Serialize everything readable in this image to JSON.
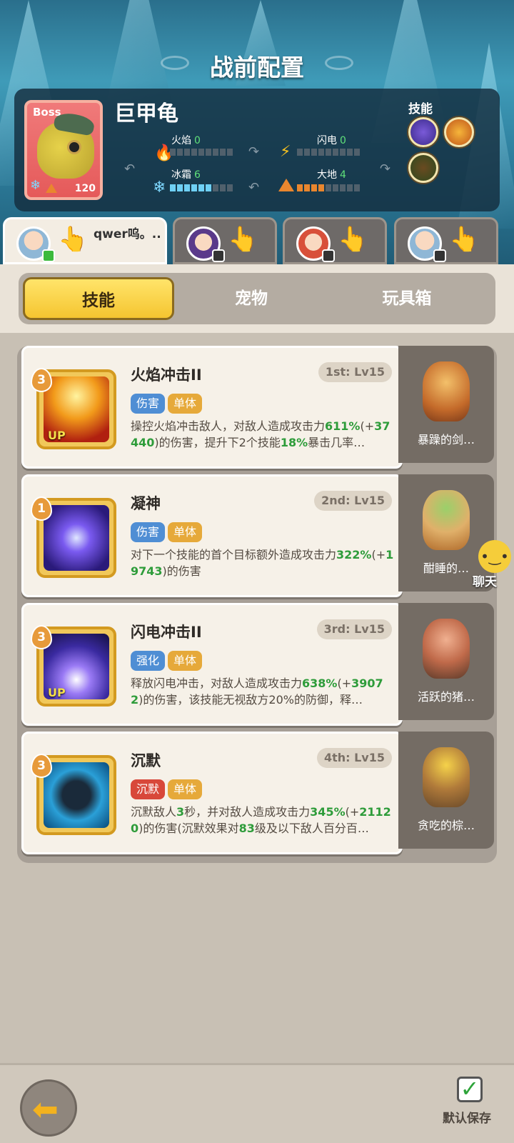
{
  "header": {
    "title": "战前配置"
  },
  "boss": {
    "tag": "Boss",
    "name": "巨甲龟",
    "level": "120",
    "stats": {
      "fire": {
        "label": "火焰",
        "value": "0"
      },
      "lightning": {
        "label": "闪电",
        "value": "0"
      },
      "ice": {
        "label": "冰霜",
        "value": "6"
      },
      "earth": {
        "label": "大地",
        "value": "4"
      }
    },
    "skills_label": "技能"
  },
  "players": [
    {
      "name": "qwer呜。.."
    },
    {
      "name": ""
    },
    {
      "name": ""
    },
    {
      "name": ""
    }
  ],
  "tabs": {
    "skills": "技能",
    "pets": "宠物",
    "toybox": "玩具箱"
  },
  "skills": [
    {
      "name": "火焰冲击II",
      "slot": "1st: Lv15",
      "level": "3",
      "up": "UP",
      "tags": [
        "伤害",
        "单体"
      ],
      "desc_a": "操控火焰冲击敌人，对敌人造成攻击力",
      "desc_b": "611%",
      "desc_c": "(+",
      "desc_d": "37440",
      "desc_e": ")的伤害，提升下2个技能",
      "desc_f": "18%",
      "desc_g": "暴击几率…",
      "pet": "暴躁的剑…"
    },
    {
      "name": "凝神",
      "slot": "2nd: Lv15",
      "level": "1",
      "tags": [
        "伤害",
        "单体"
      ],
      "desc_a": "对下一个技能的首个目标额外造成攻击力",
      "desc_b": "322%",
      "desc_c": "(+",
      "desc_d": "19743",
      "desc_e": ")的伤害",
      "pet": "酣睡的…"
    },
    {
      "name": "闪电冲击II",
      "slot": "3rd: Lv15",
      "level": "3",
      "up": "UP",
      "tags": [
        "强化",
        "单体"
      ],
      "desc_a": "释放闪电冲击，对敌人造成攻击力",
      "desc_b": "638%",
      "desc_c": "(+",
      "desc_d": "39072",
      "desc_e": ")的伤害，该技能无视敌方20%的防御，释…",
      "pet": "活跃的猪…"
    },
    {
      "name": "沉默",
      "slot": "4th: Lv15",
      "level": "3",
      "tags": [
        "沉默",
        "单体"
      ],
      "desc_a": "沉默敌人",
      "desc_b": "3",
      "desc_c": "秒，并对敌人造成攻击力",
      "desc_d": "345%",
      "desc_e": "(+",
      "desc_f": "21120",
      "desc_g": ")的伤害(沉默效果对",
      "desc_h": "83",
      "desc_i": "级及以下敌人百分百…",
      "pet": "贪吃的棕…"
    }
  ],
  "chat": {
    "label": "聊天"
  },
  "footer": {
    "save_label": "默认保存"
  },
  "colors": {
    "accent_yellow": "#f5c530",
    "green_value": "#2e9c3a"
  }
}
